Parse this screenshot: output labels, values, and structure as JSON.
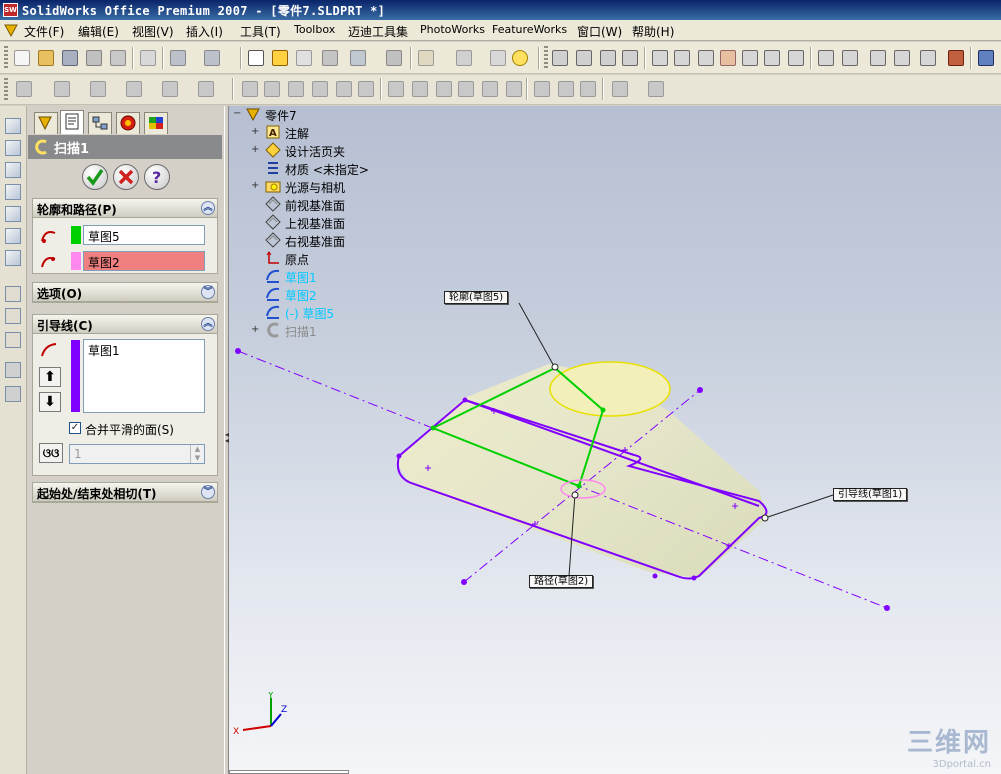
{
  "window": {
    "title": "SolidWorks Office Premium 2007 - [零件7.SLDPRT *]",
    "app_icon_text": "SW"
  },
  "menu": {
    "items": [
      "文件(F)",
      "编辑(E)",
      "视图(V)",
      "插入(I)",
      "工具(T)",
      "Toolbox",
      "迈迪工具集",
      "PhotoWorks",
      "FeatureWorks",
      "窗口(W)",
      "帮助(H)"
    ]
  },
  "property_manager": {
    "title": "扫描1",
    "sections": {
      "profile_path": {
        "label": "轮廓和路径(P)",
        "profile_value": "草图5",
        "path_value": "草图2"
      },
      "options": {
        "label": "选项(O)"
      },
      "guide_curves": {
        "label": "引导线(C)",
        "items": [
          "草图1"
        ],
        "merge_label": "合并平滑的面(S)",
        "merge_checked": true,
        "spin_value": "1"
      },
      "tangency": {
        "label": "起始处/结束处相切(T)"
      }
    }
  },
  "feature_tree": {
    "root": "零件7",
    "items": [
      {
        "label": "注解",
        "expandable": true
      },
      {
        "label": "设计活页夹",
        "expandable": true
      },
      {
        "label": "材质 <未指定>",
        "expandable": false
      },
      {
        "label": "光源与相机",
        "expandable": true
      },
      {
        "label": "前视基准面",
        "expandable": false
      },
      {
        "label": "上视基准面",
        "expandable": false
      },
      {
        "label": "右视基准面",
        "expandable": false
      },
      {
        "label": "原点",
        "expandable": false
      },
      {
        "label": "草图1",
        "expandable": false,
        "highlight": true
      },
      {
        "label": "草图2",
        "expandable": false,
        "highlight": true
      },
      {
        "label": "(-) 草图5",
        "expandable": false,
        "highlight": true
      },
      {
        "label": "扫描1",
        "expandable": true,
        "greyed": true
      }
    ]
  },
  "callouts": {
    "profile": "轮廓(草图5)",
    "guide": "引导线(草图1)",
    "path": "路径(草图2)"
  },
  "triad": {
    "x": "X",
    "y": "Y",
    "z": "Z"
  },
  "watermark": {
    "main": "三维网",
    "sub": "3Dportal.cn"
  },
  "colors": {
    "accent_blue": "#0a246a",
    "profile_green": "#00d000",
    "path_pink": "#ff88ee",
    "guide_purple": "#8000ff",
    "feature_highlight": "#00c8ff"
  }
}
